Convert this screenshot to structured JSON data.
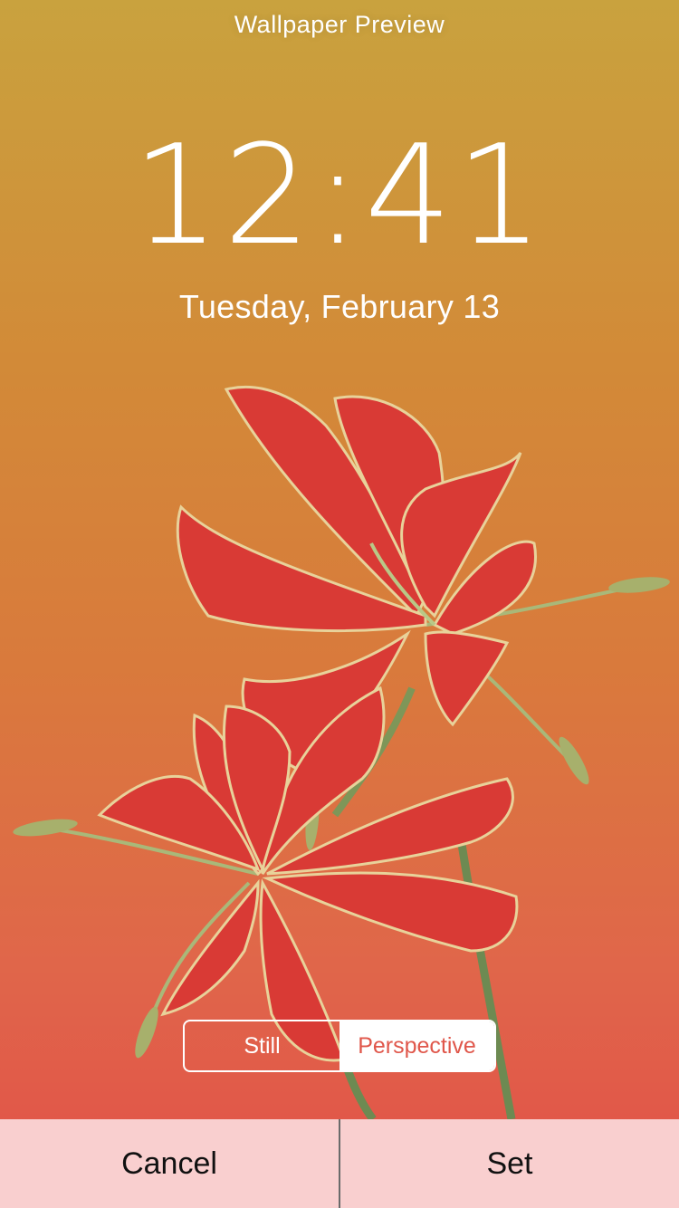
{
  "header": {
    "title": "Wallpaper Preview"
  },
  "lock_screen": {
    "time": "12:41",
    "date": "Tuesday, February 13"
  },
  "motion_toggle": {
    "options": [
      {
        "label": "Still",
        "selected": false
      },
      {
        "label": "Perspective",
        "selected": true
      }
    ]
  },
  "actions": {
    "cancel_label": "Cancel",
    "set_label": "Set"
  },
  "colors": {
    "background_top": "#c9a23e",
    "background_bottom": "#e25048",
    "petal": "#d93a35",
    "selected_segment_text": "#e0574b",
    "action_bar": "#f9cfcf"
  }
}
